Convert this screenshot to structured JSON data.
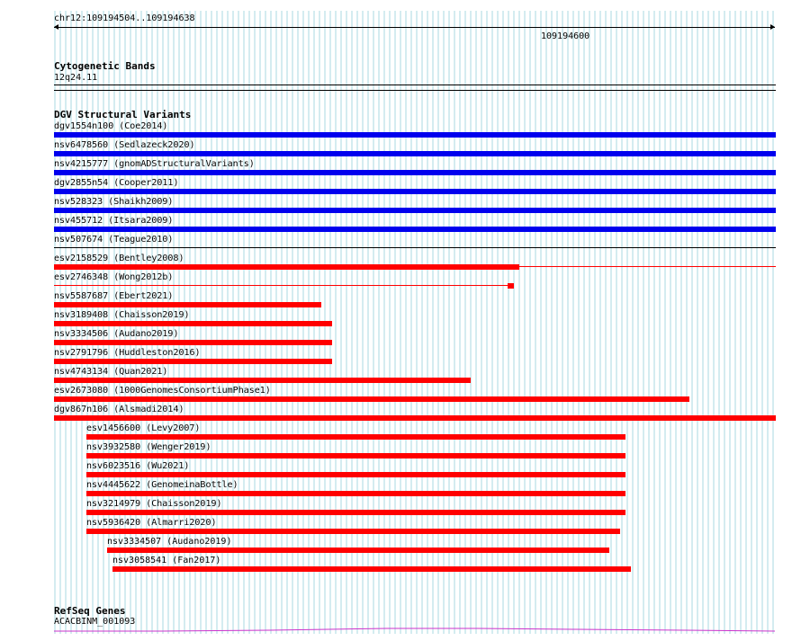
{
  "ruler": {
    "range_label": "chr12:109194504..109194638",
    "tick_label": "109194600"
  },
  "cytobands": {
    "title": "Cytogenetic Bands",
    "band": "12q24.11"
  },
  "dgv": {
    "title": "DGV Structural Variants",
    "variants": [
      {
        "label": "dgv1554n100 (Coe2014)",
        "type": "gain"
      },
      {
        "label": "nsv6478560 (Sedlazeck2020)",
        "type": "gain"
      },
      {
        "label": "nsv4215777 (gnomADStructuralVariants)",
        "type": "gain"
      },
      {
        "label": "dgv2855n54 (Cooper2011)",
        "type": "gain"
      },
      {
        "label": "nsv528323 (Shaikh2009)",
        "type": "gain"
      },
      {
        "label": "nsv455712 (Itsara2009)",
        "type": "gain"
      },
      {
        "label": "nsv507674 (Teague2010)",
        "type": "complex"
      },
      {
        "label": "esv2158529 (Bentley2008)",
        "type": "loss"
      },
      {
        "label": "esv2746348 (Wong2012b)",
        "type": "loss"
      },
      {
        "label": "nsv5587687 (Ebert2021)",
        "type": "loss"
      },
      {
        "label": "nsv3189408 (Chaisson2019)",
        "type": "loss"
      },
      {
        "label": "nsv3334506 (Audano2019)",
        "type": "loss"
      },
      {
        "label": "nsv2791796 (Huddleston2016)",
        "type": "loss"
      },
      {
        "label": "nsv4743134 (Quan2021)",
        "type": "loss"
      },
      {
        "label": "esv2673080 (1000GenomesConsortiumPhase1)",
        "type": "loss"
      },
      {
        "label": "dgv867n106 (Alsmadi2014)",
        "type": "loss"
      },
      {
        "label": "esv1456600 (Levy2007)",
        "type": "loss"
      },
      {
        "label": "nsv3932580 (Wenger2019)",
        "type": "loss"
      },
      {
        "label": "nsv6023516 (Wu2021)",
        "type": "loss"
      },
      {
        "label": "nsv4445622 (GenomeinaBottle)",
        "type": "loss"
      },
      {
        "label": "nsv3214979 (Chaisson2019)",
        "type": "loss"
      },
      {
        "label": "nsv5936420 (Almarri2020)",
        "type": "loss"
      },
      {
        "label": "nsv3334507 (Audano2019)",
        "type": "loss"
      },
      {
        "label": "nsv3058541 (Fan2017)",
        "type": "loss"
      }
    ]
  },
  "refseq": {
    "title": "RefSeq Genes",
    "gene": "ACACBINM_001093"
  },
  "colors": {
    "gain": "#0000ee",
    "loss": "#ff0000",
    "gene": "#cc33cc",
    "grid": "#a8d8e0"
  }
}
